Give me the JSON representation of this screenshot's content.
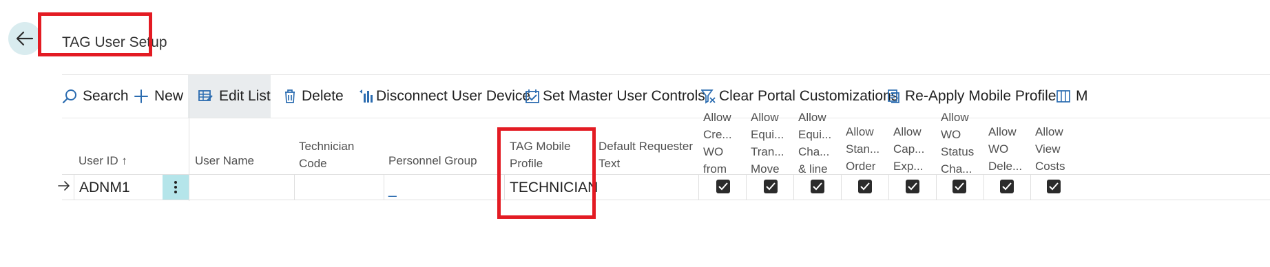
{
  "page": {
    "title": "TAG User Setup"
  },
  "toolbar": {
    "search": "Search",
    "new": "New",
    "edit_list": "Edit List",
    "delete": "Delete",
    "disconnect": "Disconnect User Device",
    "set_master": "Set Master User Controls",
    "clear_portal": "Clear Portal Customizations",
    "reapply": "Re-Apply Mobile Profile",
    "more": "M"
  },
  "columns": {
    "user_id": "User ID ↑",
    "user_name": "User Name",
    "technician_code_1": "Technician",
    "technician_code_2": "Code",
    "personnel_group": "Personnel Group",
    "tag_mobile_1": "TAG Mobile",
    "tag_mobile_2": "Profile",
    "default_req_1": "Default Requester",
    "default_req_2": "Text",
    "allow_cols": [
      [
        "Allow",
        "Cre...",
        "WO",
        "from"
      ],
      [
        "Allow",
        "Equi...",
        "Tran...",
        "Move"
      ],
      [
        "Allow",
        "Equi...",
        "Cha...",
        "& line"
      ],
      [
        "Allow",
        "Stan...",
        "Order"
      ],
      [
        "Allow",
        "Cap...",
        "Exp..."
      ],
      [
        "Allow",
        "WO",
        "Status",
        "Cha..."
      ],
      [
        "Allow",
        "WO",
        "Dele..."
      ],
      [
        "Allow",
        "View",
        "Costs"
      ]
    ]
  },
  "row": {
    "user_id": "ADNM1",
    "personnel_group": "_",
    "tag_mobile_profile": "TECHNICIAN",
    "checks": [
      true,
      true,
      true,
      true,
      true,
      true,
      true,
      true
    ]
  }
}
